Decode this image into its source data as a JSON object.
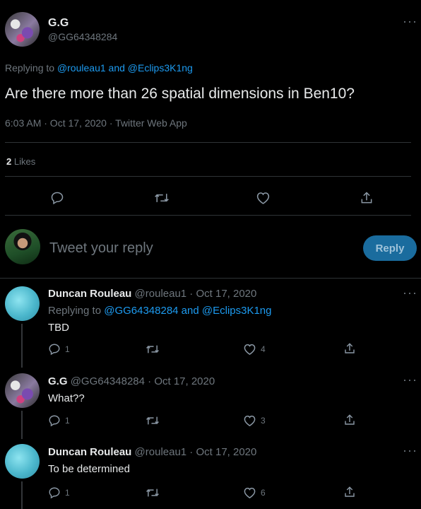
{
  "main_tweet": {
    "name": "G.G",
    "handle": "@GG64348284",
    "replying_prefix": "Replying to",
    "replying_user1": "@rouleau1",
    "replying_and": "and",
    "replying_user2": "@Eclips3K1ng",
    "text": "Are there more than 26 spatial dimensions in Ben10?",
    "timestamp": "6:03 AM · Oct 17, 2020 · Twitter Web App",
    "likes_count": "2",
    "likes_label": "Likes"
  },
  "compose": {
    "placeholder": "Tweet your reply",
    "button_label": "Reply"
  },
  "replies": [
    {
      "name": "Duncan Rouleau",
      "meta": "@rouleau1 · Oct 17, 2020",
      "replying_prefix": "Replying to",
      "replying_users": "@GG64348284 and @Eclips3K1ng",
      "text": "TBD",
      "reply_count": "1",
      "retweet_count": "",
      "like_count": "4"
    },
    {
      "name": "G.G",
      "meta": "@GG64348284 · Oct 17, 2020",
      "text": "What??",
      "reply_count": "1",
      "retweet_count": "",
      "like_count": "3"
    },
    {
      "name": "Duncan Rouleau",
      "meta": "@rouleau1 · Oct 17, 2020",
      "text": "To be determined",
      "reply_count": "1",
      "retweet_count": "",
      "like_count": "6"
    }
  ],
  "icons": {
    "more": "more-horizontal-icon",
    "reply": "reply-bubble-icon",
    "retweet": "retweet-icon",
    "like": "heart-icon",
    "share": "share-icon"
  },
  "colors": {
    "background": "#000000",
    "accent": "#1d9bf0",
    "muted": "#6e767d",
    "reply_button": "#1a6c9e"
  }
}
